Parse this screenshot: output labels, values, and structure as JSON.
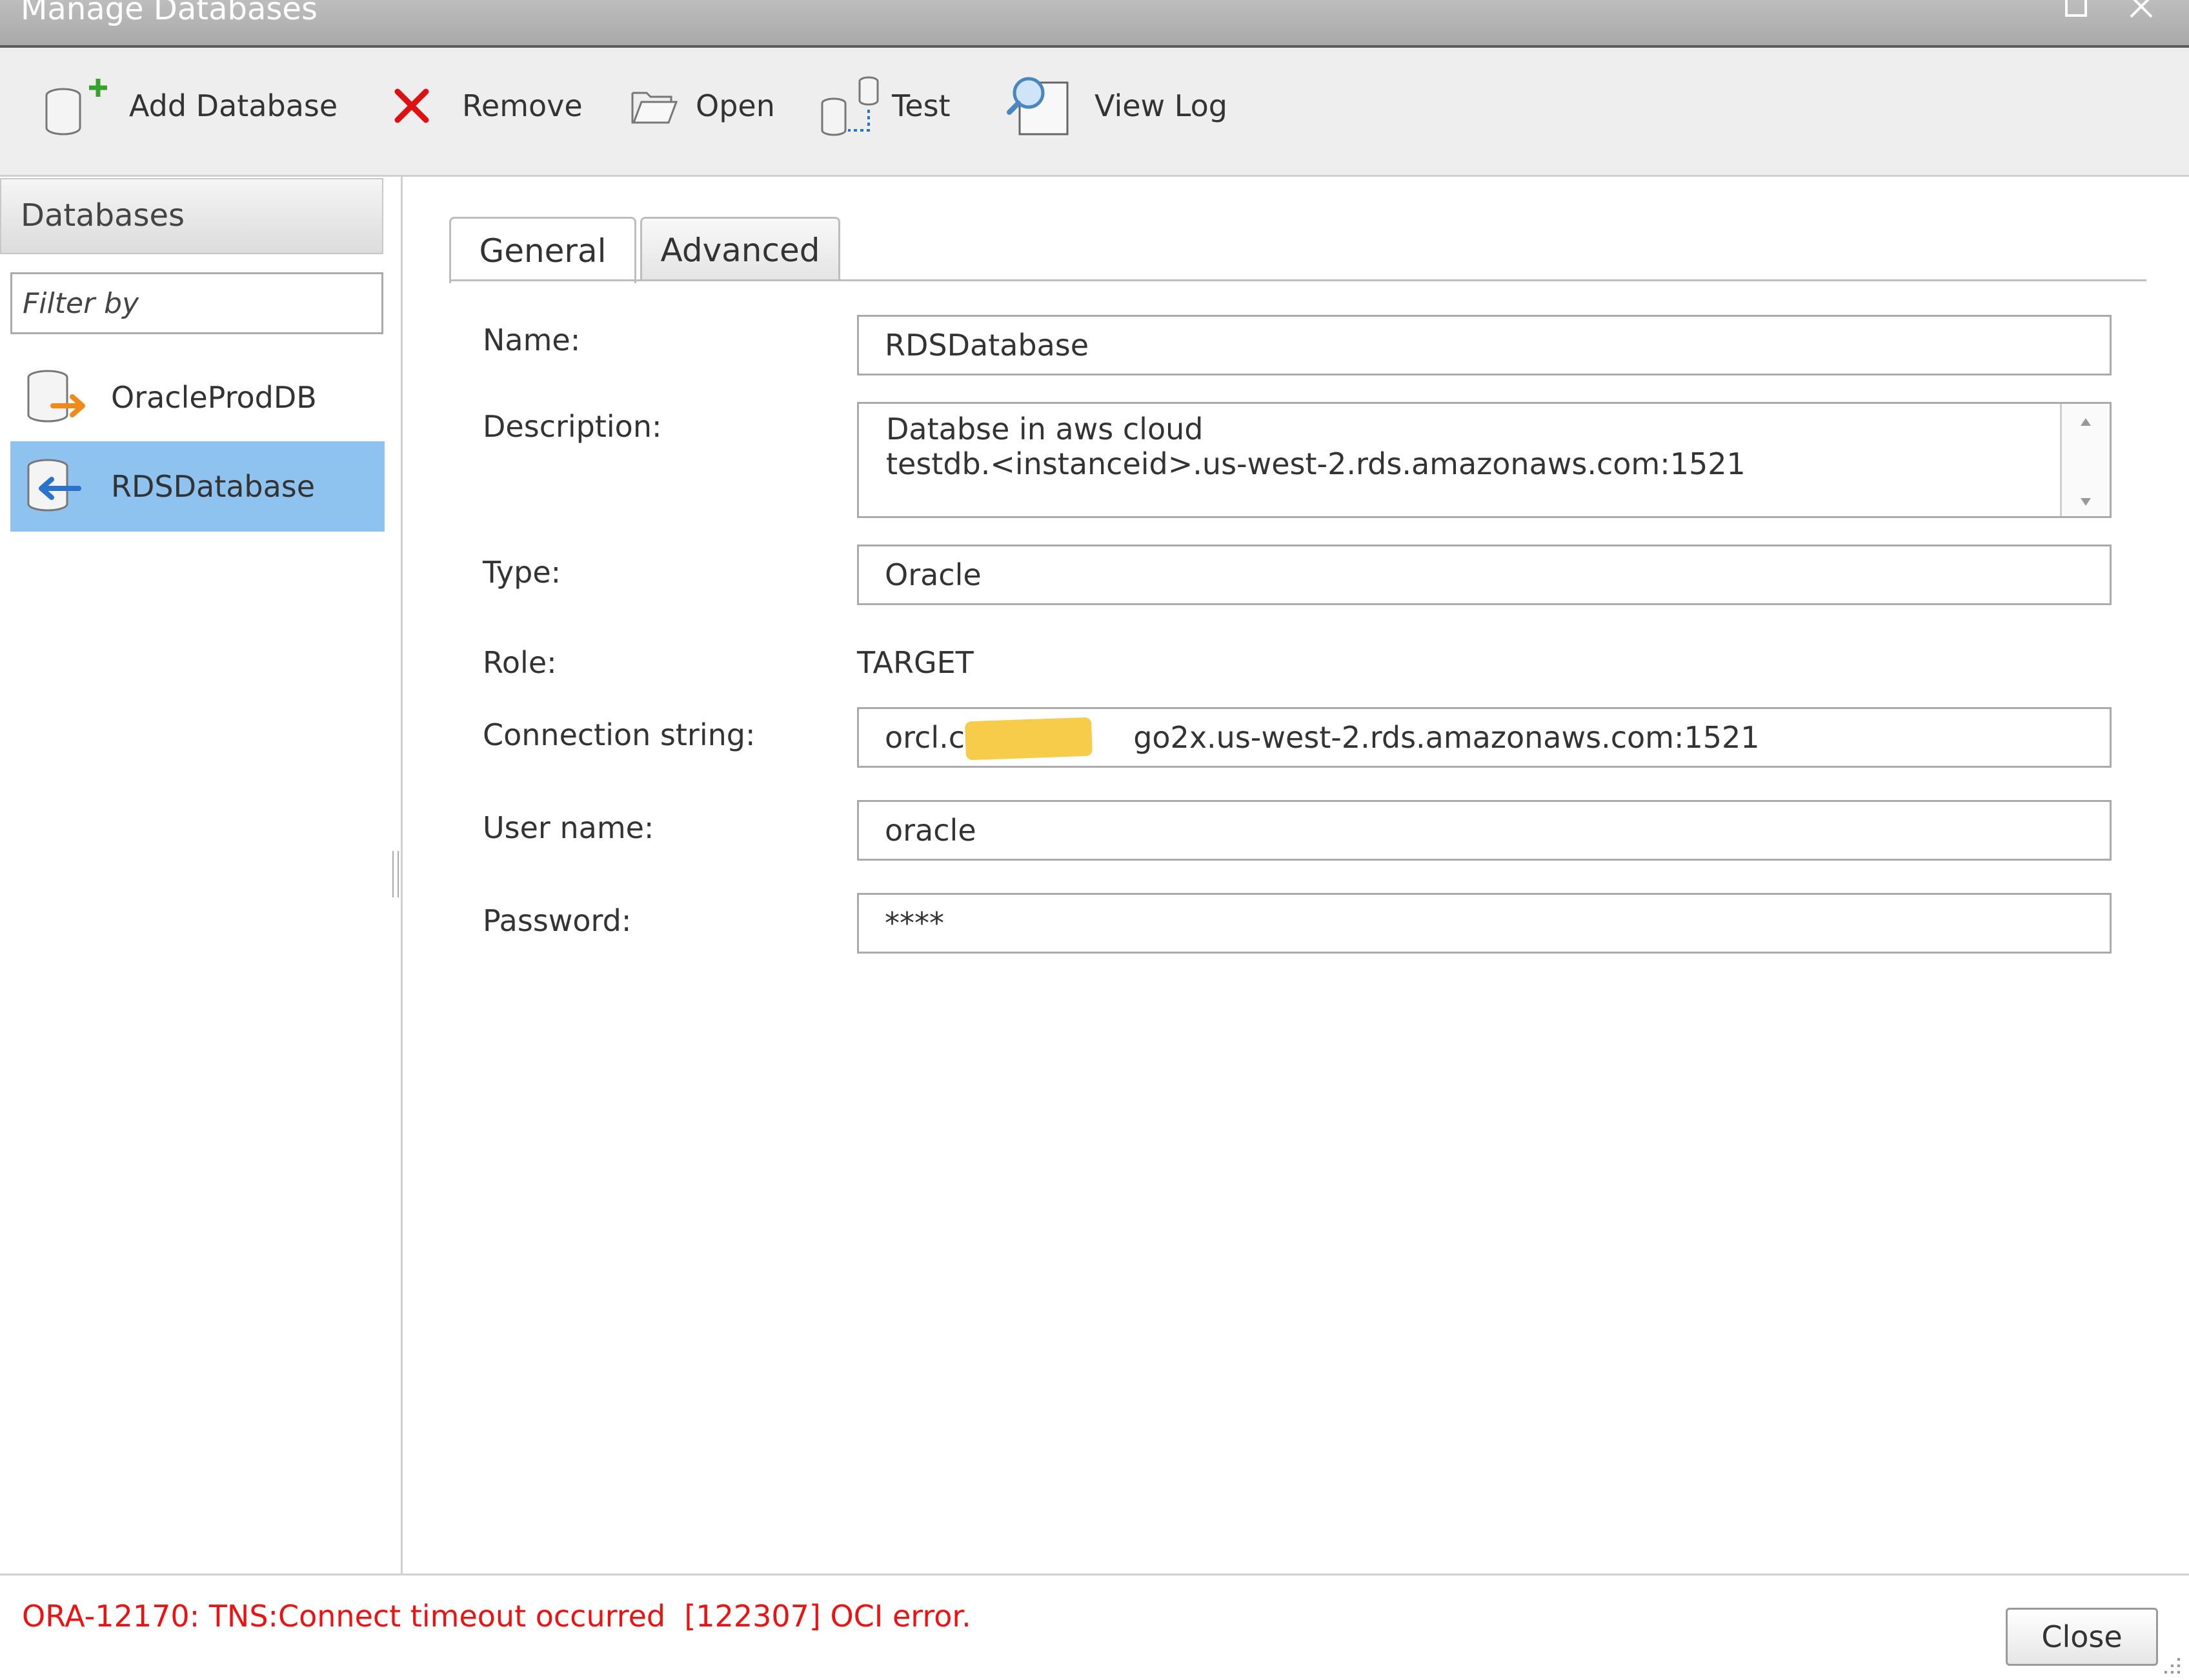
{
  "window": {
    "title": "Manage Databases"
  },
  "toolbar": {
    "add_label": "Add Database",
    "remove_label": "Remove",
    "open_label": "Open",
    "test_label": "Test",
    "view_log_label": "View Log"
  },
  "sidebar": {
    "header": "Databases",
    "filter_placeholder": "Filter by",
    "items": [
      {
        "label": "OracleProdDB",
        "selected": false
      },
      {
        "label": "RDSDatabase",
        "selected": true
      }
    ]
  },
  "tabs": [
    {
      "label": "General",
      "active": true
    },
    {
      "label": "Advanced",
      "active": false
    }
  ],
  "form": {
    "name_label": "Name:",
    "name_value": "RDSDatabase",
    "description_label": "Description:",
    "description_value": "Databse in aws cloud\ntestdb.<instanceid>.us-west-2.rds.amazonaws.com:1521",
    "type_label": "Type:",
    "type_value": "Oracle",
    "role_label": "Role:",
    "role_value": "TARGET",
    "connection_label": "Connection string:",
    "connection_value": "orcl.cv                go2x.us-west-2.rds.amazonaws.com:1521",
    "username_label": "User name:",
    "username_value": "oracle",
    "password_label": "Password:",
    "password_value": "****"
  },
  "status": {
    "error_text": "ORA-12170: TNS:Connect timeout occurred  [122307] OCI error.",
    "close_label": "Close"
  },
  "colors": {
    "selection": "#8ec2ef",
    "error": "#ee1111",
    "add_plus": "#3aa02e",
    "remove_x": "#dd1111",
    "source_arrow": "#f08a1a",
    "target_arrow": "#2a73cc",
    "redaction": "#f7cc4a"
  }
}
